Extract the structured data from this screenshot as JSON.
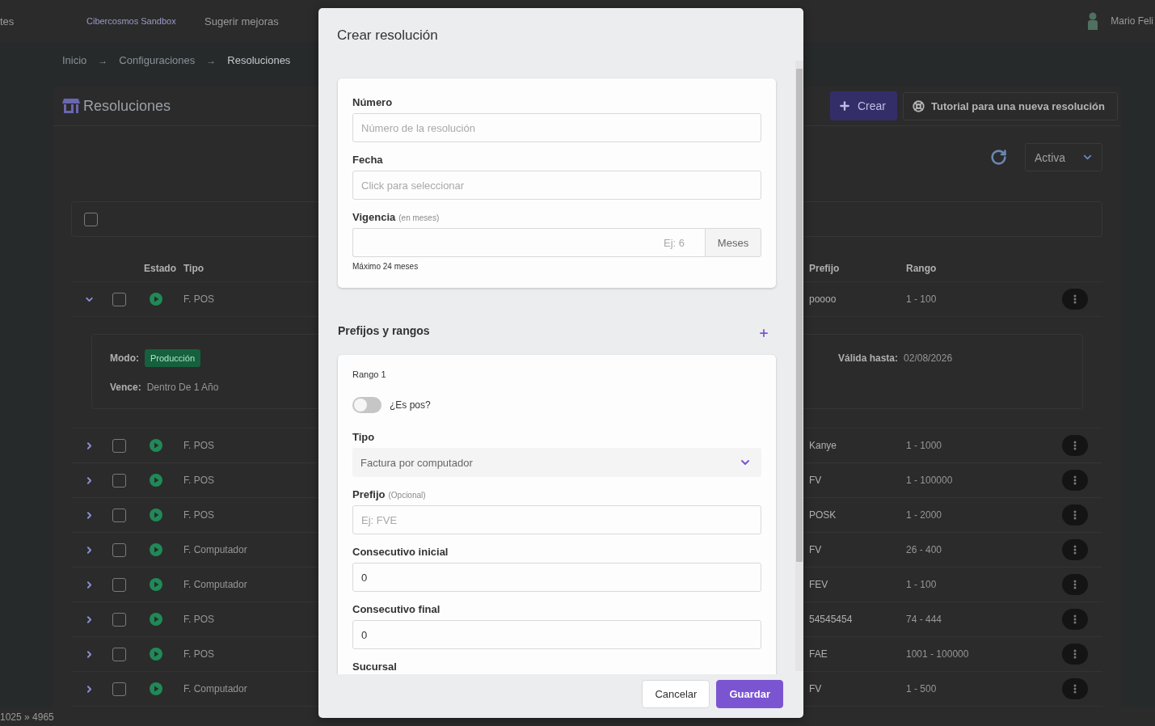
{
  "top_bar": {
    "nav_link": "tes",
    "workspace": "Cibercosmos Sandbox",
    "feedback_link": "Sugerir mejoras",
    "user_name": "Mario Feli"
  },
  "breadcrumbs": [
    {
      "label": "Inicio",
      "current": false,
      "separator": "→"
    },
    {
      "label": "Configuraciones",
      "current": false,
      "separator": "→"
    },
    {
      "label": "Resoluciones",
      "current": true
    }
  ],
  "page": {
    "title": "Resoluciones",
    "create_button": "Crear",
    "tutorial_button": "Tutorial para una nueva resolución",
    "status_filter": "Activa"
  },
  "table": {
    "select_all": {
      "checked": false
    },
    "columns": [
      "Estado",
      "Tipo",
      "Prefijo",
      "Rango"
    ],
    "rows": [
      {
        "type": "F. POS",
        "prefix": "poooo",
        "range": "1 - 100",
        "checked": false,
        "expanded": true,
        "details": [
          {
            "kind": "badge",
            "label": "Modo:",
            "value": "Producción"
          },
          {
            "kind": "text",
            "label": "Vence:",
            "value": "Dentro De 1 Año"
          },
          {
            "kind": "text",
            "label": "Válida hasta:",
            "value": "02/08/2026"
          }
        ]
      },
      {
        "type": "F. POS",
        "prefix": "Kanye",
        "range": "1 - 1000",
        "checked": false,
        "expanded": false
      },
      {
        "type": "F. POS",
        "prefix": "FV",
        "range": "1 - 100000",
        "checked": false,
        "expanded": false
      },
      {
        "type": "F. POS",
        "prefix": "POSK",
        "range": "1 - 2000",
        "checked": false,
        "expanded": false
      },
      {
        "type": "F. Computador",
        "prefix": "FV",
        "range": "26 - 400",
        "checked": false,
        "expanded": false
      },
      {
        "type": "F. Computador",
        "prefix": "FEV",
        "range": "1 - 100",
        "checked": false,
        "expanded": false
      },
      {
        "type": "F. POS",
        "prefix": "54545454",
        "range": "74 - 444",
        "checked": false,
        "expanded": false
      },
      {
        "type": "F. POS",
        "prefix": "FAE",
        "range": "1001 - 100000",
        "checked": false,
        "expanded": false
      },
      {
        "type": "F. Computador",
        "prefix": "FV",
        "range": "1 - 500",
        "checked": false,
        "expanded": false
      }
    ]
  },
  "modal": {
    "title": "Crear resolución",
    "general_fields": [
      {
        "kind": "text",
        "label": "Número",
        "placeholder": "Número de la resolución"
      },
      {
        "kind": "text",
        "label": "Fecha",
        "placeholder": "Click para seleccionar"
      },
      {
        "kind": "addon",
        "label": "Vigencia",
        "hint": "(en meses)",
        "placeholder": "Ej: 6",
        "addon": "Meses",
        "help": "Máximo 24 meses"
      }
    ],
    "ranges_title": "Prefijos y rangos",
    "ranges": [
      {
        "title": "Rango 1",
        "fields": [
          {
            "kind": "toggle",
            "label": "¿Es pos?",
            "on": false
          },
          {
            "kind": "select",
            "label": "Tipo",
            "value": "Factura por computador"
          },
          {
            "kind": "text",
            "label": "Prefijo",
            "hint": "(Opcional)",
            "placeholder": "Ej: FVE"
          },
          {
            "kind": "text",
            "label": "Consecutivo inicial",
            "value": "0"
          },
          {
            "kind": "text",
            "label": "Consecutivo final",
            "value": "0"
          },
          {
            "kind": "label",
            "label": "Sucursal"
          }
        ]
      }
    ],
    "buttons": [
      {
        "kind": "secondary",
        "label": "Cancelar"
      },
      {
        "kind": "primary",
        "label": "Guardar"
      }
    ]
  },
  "size_readout": "1025 » 4965"
}
